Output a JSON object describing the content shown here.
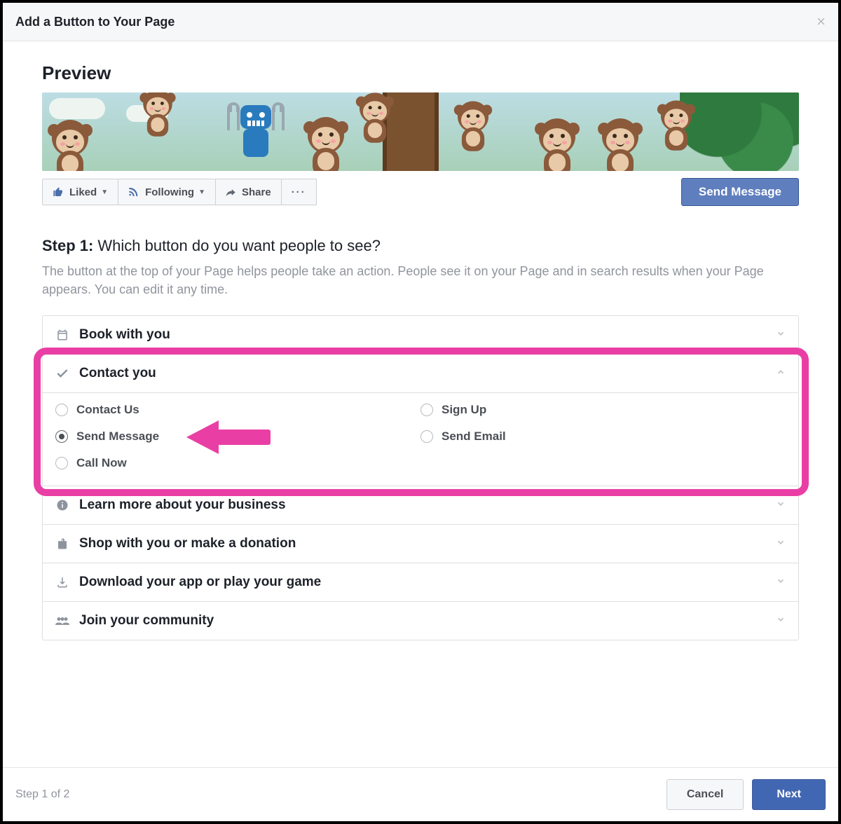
{
  "modal": {
    "title": "Add a Button to Your Page",
    "close_label": "×"
  },
  "preview": {
    "heading": "Preview",
    "liked": "Liked",
    "following": "Following",
    "share": "Share",
    "more": "···",
    "cta": "Send Message"
  },
  "step": {
    "prefix": "Step 1:",
    "question": "Which button do you want people to see?",
    "description": "The button at the top of your Page helps people take an action. People see it on your Page and in search results when your Page appears. You can edit it any time."
  },
  "categories": [
    {
      "id": "book",
      "label": "Book with you",
      "icon": "calendar",
      "expanded": false
    },
    {
      "id": "contact",
      "label": "Contact you",
      "icon": "check",
      "expanded": true,
      "options": [
        {
          "id": "contact_us",
          "label": "Contact Us",
          "selected": false
        },
        {
          "id": "send_message",
          "label": "Send Message",
          "selected": true
        },
        {
          "id": "call_now",
          "label": "Call Now",
          "selected": false
        },
        {
          "id": "sign_up",
          "label": "Sign Up",
          "selected": false
        },
        {
          "id": "send_email",
          "label": "Send Email",
          "selected": false
        }
      ]
    },
    {
      "id": "learn",
      "label": "Learn more about your business",
      "icon": "info",
      "expanded": false
    },
    {
      "id": "shop",
      "label": "Shop with you or make a donation",
      "icon": "bag",
      "expanded": false
    },
    {
      "id": "download",
      "label": "Download your app or play your game",
      "icon": "download",
      "expanded": false
    },
    {
      "id": "community",
      "label": "Join your community",
      "icon": "people",
      "expanded": false
    }
  ],
  "annotation": {
    "highlight_category": "contact",
    "arrow_target_option": "send_message"
  },
  "footer": {
    "step_indicator": "Step 1 of 2",
    "cancel": "Cancel",
    "next": "Next"
  }
}
